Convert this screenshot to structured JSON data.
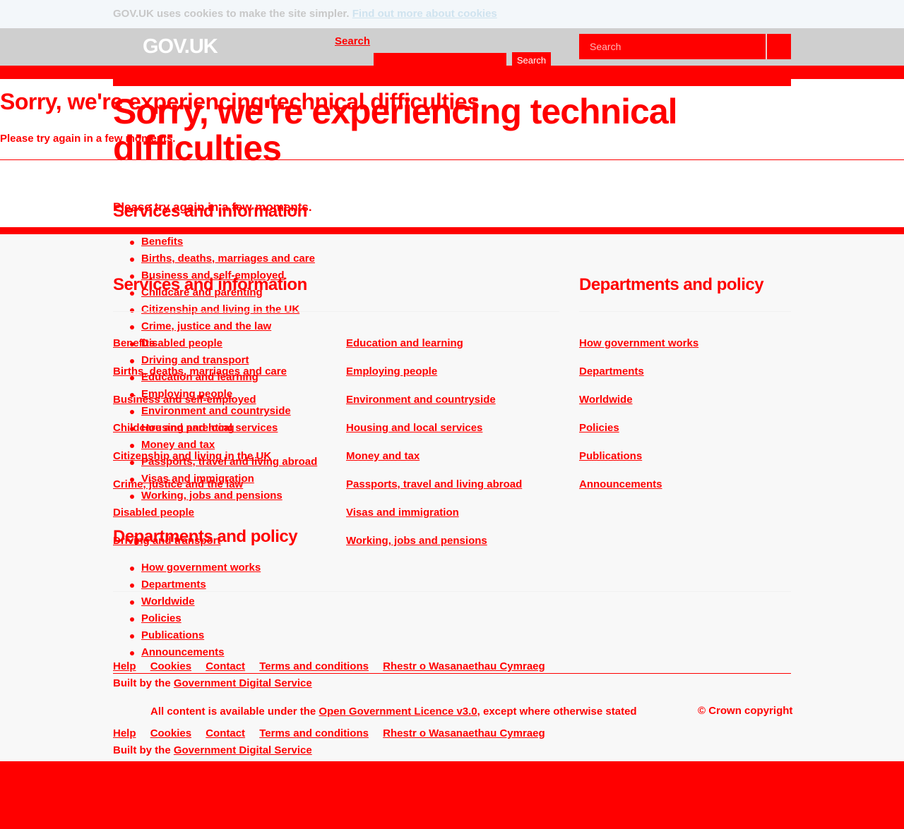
{
  "cookie_banner": {
    "text": "GOV.UK uses cookies to make the site simpler.",
    "link": "Find out more about cookies"
  },
  "header": {
    "logo": "GOV.UK",
    "search_link": "Search",
    "mini_search_button": "Search",
    "search_placeholder": "Search"
  },
  "main": {
    "title": "Sorry, we're experiencing technical difficulties",
    "message": "Please try again in a few moments."
  },
  "services_heading": "Services and information",
  "departments_heading": "Departments and policy",
  "services_items": [
    "Benefits",
    "Births, deaths, marriages and care",
    "Business and self-employed",
    "Childcare and parenting",
    "Citizenship and living in the UK",
    "Crime, justice and the law",
    "Disabled people",
    "Driving and transport",
    "Education and learning",
    "Employing people",
    "Environment and countryside",
    "Housing and local services",
    "Money and tax",
    "Passports, travel and living abroad",
    "Visas and immigration",
    "Working, jobs and pensions"
  ],
  "departments_items": [
    "How government works",
    "Departments",
    "Worldwide",
    "Policies",
    "Publications",
    "Announcements"
  ],
  "footer": {
    "meta_links": [
      "Help",
      "Cookies",
      "Contact",
      "Terms and conditions",
      "Rhestr o Wasanaethau Cymraeg"
    ],
    "built_by_prefix": "Built by the",
    "built_by_link": "Government Digital Service",
    "licence_prefix": "All content is available under the",
    "licence_link": "Open Government Licence v3.0",
    "licence_suffix": ", except where otherwise stated",
    "copyright": "© Crown copyright"
  },
  "colors": {
    "text_accent": "#ff0000",
    "header_background": "#cfcfcf",
    "cookie_background": "#f3f7fa",
    "page_background": "#f8f8f8"
  },
  "icons": {
    "search_button": "search-icon"
  }
}
